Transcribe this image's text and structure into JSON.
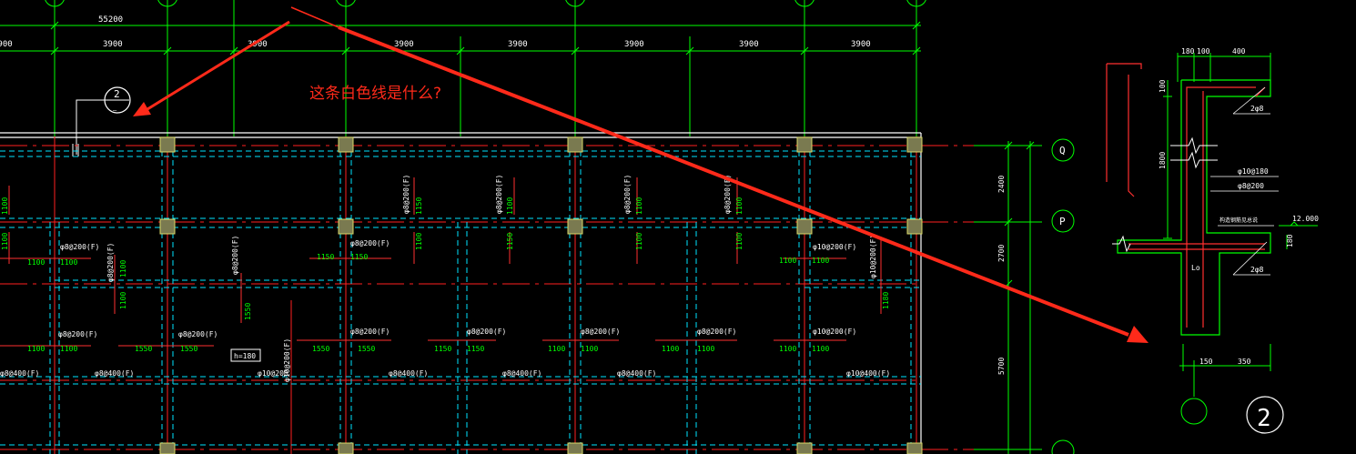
{
  "question": "这条白色线是什么?",
  "colors": {
    "background": "#000000",
    "grid_line": "#00ff00",
    "axis_line": "#ff0000",
    "dashed_beam": "#00ffff",
    "white_line": "#ffffff",
    "column_fill": "#7a7a50",
    "column_edge": "#d9d96a",
    "annotation_arrow": "#ff2a1a",
    "rebar_text": "#ffffff",
    "length_text": "#00ff00"
  },
  "dimensions": {
    "overall": "55200",
    "top_spans": [
      "3900",
      "3900",
      "3900",
      "3900",
      "3900",
      "3900"
    ],
    "partial_span": "3900",
    "right_spans": [
      "2400",
      "2700",
      "5700"
    ]
  },
  "axes": {
    "right_labels": [
      "Q",
      "P",
      ""
    ]
  },
  "section_callout": {
    "number": "2",
    "sub": "—"
  },
  "plan_labels": {
    "top_row_vertical_rebar": [
      "φ8@200(F)",
      "φ8@200(F)",
      "φ8@200(F)",
      "φ8@200(F)"
    ],
    "top_row_lengths": [
      "1100",
      "1150",
      "1100",
      "1100",
      "1100",
      "1100",
      "1100"
    ],
    "row2_rebar": [
      "φ8@200(F)",
      "φ8@200(F)",
      "φ10@200(F)"
    ],
    "row2_lengths": [
      "1100",
      "1100",
      "1150",
      "1150",
      "1100",
      "1100"
    ],
    "row2_vertical": [
      "φ8@200(F)",
      "φ8@200(F)",
      "φ8@200(F)",
      "φ10@200(F)",
      "φ10@200(F)"
    ],
    "row2_vertical_lengths": [
      "1100",
      "1550",
      "1150",
      "1180"
    ],
    "row3_rebar": [
      "φ8@200(F)",
      "φ8@200(F)",
      "φ8@200(F)",
      "φ8@200(F)",
      "φ8@200(F)",
      "φ8@200(F)",
      "φ8@200(F)",
      "φ10@200(F)"
    ],
    "row3_lengths": [
      "1100",
      "1100",
      "1550",
      "1550",
      "1550",
      "1550",
      "1150",
      "1150",
      "1100",
      "1100",
      "1100",
      "1100",
      "1100",
      "1100"
    ],
    "slab_thickness": "h=180",
    "bottom_rebar": [
      "φ8@400(F)",
      "φ8@400(F)",
      "φ10@200",
      "φ8@400(F)",
      "φ8@400(F)",
      "φ8@400(F)",
      "φ10@400(F)"
    ]
  },
  "section_detail": {
    "top_dims": [
      "180",
      "100",
      "400"
    ],
    "left_dims": [
      "100",
      "1800"
    ],
    "rebar": [
      "φ10@180",
      "φ8@200"
    ],
    "notes": [
      "2φ8",
      "2φ8",
      "构造钢筋见总说"
    ],
    "level": "12.000",
    "beam_height": "180",
    "lo": "Lo",
    "bottom_dims": [
      "150",
      "350"
    ],
    "callout_number": "2"
  }
}
